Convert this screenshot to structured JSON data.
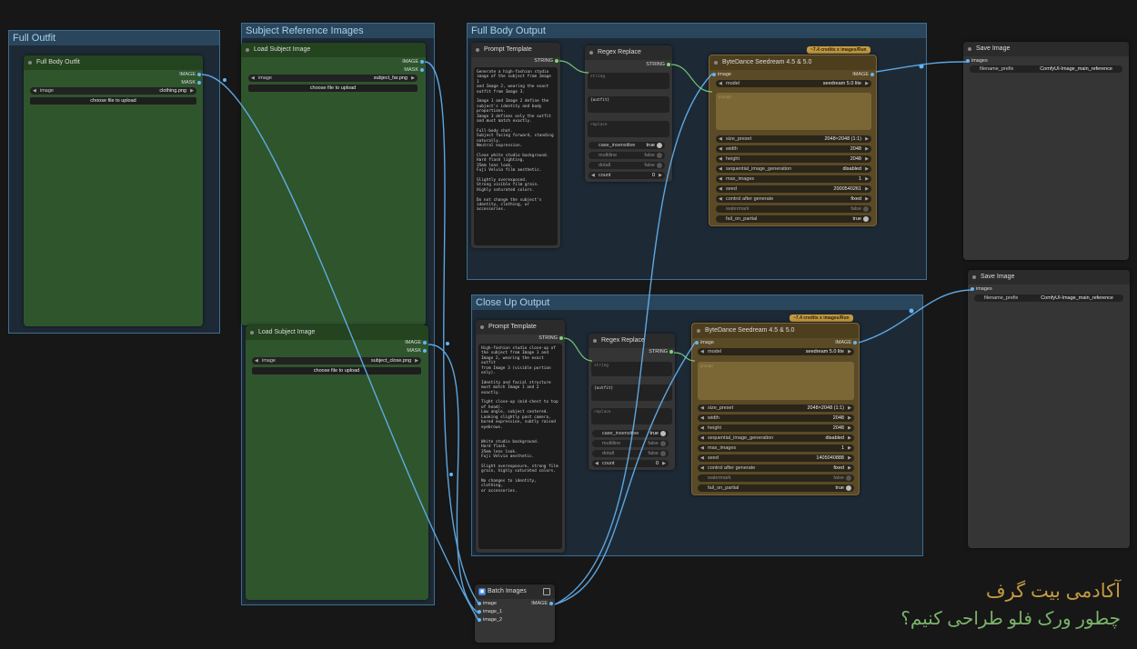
{
  "groups": {
    "full_outfit": "Full Outfit",
    "subject_reference": "Subject Reference Images",
    "full_body_output": "Full Body Output",
    "close_up_output": "Close Up Output"
  },
  "slots": {
    "image_out": "IMAGE",
    "mask_out": "MASK",
    "string_out": "STRING",
    "image_in": "image",
    "images_in": "images",
    "image_1": "image_1",
    "image_2": "image_2"
  },
  "upload_label": "choose file to upload",
  "image_label": "image",
  "full_body_outfit": {
    "title": "Full Body Outfit",
    "file": "clothing.png"
  },
  "load_subject_far": {
    "title": "Load Subject Image",
    "file": "subject_far.png"
  },
  "load_subject_close": {
    "title": "Load Subject Image",
    "file": "subject_close.png"
  },
  "prompt_full": {
    "title": "Prompt Template",
    "text": "Generate a high-fashion studio\nimage of the subject from Image 1\nand Image 2, wearing the exact\noutfit from Image 3.\n\nImage 1 and Image 2 define the\nsubject's identity and body\nproportions.\nImage 3 defines only the outfit\nand must match exactly.\n\nFull-body shot.\nSubject facing forward, standing\nnaturally.\nNeutral expression.\n\nClean white studio background.\nHard flash lighting.\n35mm lens look.\nFuji Velvia film aesthetic.\n\nSlightly overexposed.\nStrong visible film grain.\nHighly saturated colors.\n\nDo not change the subject's\nidentity, clothing, or\naccessories."
  },
  "prompt_close": {
    "title": "Prompt Template",
    "text": "High-fashion studio close-up of\nthe subject from Image 1 and\nImage 2, wearing the exact outfit\nfrom Image 3 (visible portion\nonly).\n\nIdentity and facial structure\nmust match Image 1 and 2 exactly.\n\nTight close-up (mid-chest to top\nof head).\nLow angle, subject centered.\nLooking slightly past camera,\nbored expression, subtly raised\neyebrows.\n\n\nWhite studio background.\nHard flash.\n35mm lens look.\nFuji Velvia aesthetic.\n\nSlight overexposure, strong film\ngrain, highly saturated colors.\n\nNo changes to identity, clothing,\nor accessories."
  },
  "regex": {
    "title": "Regex Replace",
    "string_ph": "string",
    "regex_value": "{outfit}",
    "replace_ph": "replace",
    "case_label": "case_insensitive",
    "case_value": "true",
    "multiline_label": "multiline",
    "multiline_value": "false",
    "dotall_label": "dotall",
    "dotall_value": "false",
    "count_label": "count",
    "count_value": "0"
  },
  "seedream_full": {
    "title": "ByteDance Seedream 4.5 & 5.0",
    "badge": "~7.4 credits x images/Run",
    "model_label": "model",
    "model_value": "seedream 5.0 lite",
    "prompt_ph": "prompt",
    "size_label": "size_preset",
    "size_value": "2048×2048 (1:1)",
    "width_label": "width",
    "width_value": "2048",
    "height_label": "height",
    "height_value": "2048",
    "seq_label": "sequential_image_generation",
    "seq_value": "disabled",
    "max_label": "max_images",
    "max_value": "1",
    "seed_label": "seed",
    "seed_value": "2000540261",
    "ctrl_label": "control after generate",
    "ctrl_value": "fixed",
    "wm_label": "watermark",
    "wm_value": "false",
    "fail_label": "fail_on_partial",
    "fail_value": "true"
  },
  "seedream_close": {
    "title": "ByteDance Seedream 4.5 & 5.0",
    "badge": "~7.4 credits x images/Run",
    "model_label": "model",
    "model_value": "seedream 5.0 lite",
    "prompt_ph": "prompt",
    "size_label": "size_preset",
    "size_value": "2048×2048 (1:1)",
    "width_label": "width",
    "width_value": "2048",
    "height_label": "height",
    "height_value": "2048",
    "seq_label": "sequential_image_generation",
    "seq_value": "disabled",
    "max_label": "max_images",
    "max_value": "1",
    "seed_label": "seed",
    "seed_value": "1405040888",
    "ctrl_label": "control after generate",
    "ctrl_value": "fixed",
    "wm_label": "watermark",
    "wm_value": "false",
    "fail_label": "fail_on_partial",
    "fail_value": "true"
  },
  "save1": {
    "title": "Save Image",
    "prefix_label": "filename_prefix",
    "prefix_value": "ComfyUI-Image_main_reference"
  },
  "save2": {
    "title": "Save Image",
    "prefix_label": "filename_prefix",
    "prefix_value": "ComfyUI-Image_main_reference"
  },
  "batch": {
    "title": "Batch Images"
  },
  "brand": {
    "line1": "آکادمی بیت گرف",
    "line2": "چطور ورک فلو طراحی کنیم؟",
    "color1": "#c49a40",
    "color2": "#7bb36b"
  },
  "colors": {
    "wire": "#64b5f6",
    "group": "#3e6d91",
    "node_green": "#2f552d",
    "node_brown": "#5b4a26"
  }
}
